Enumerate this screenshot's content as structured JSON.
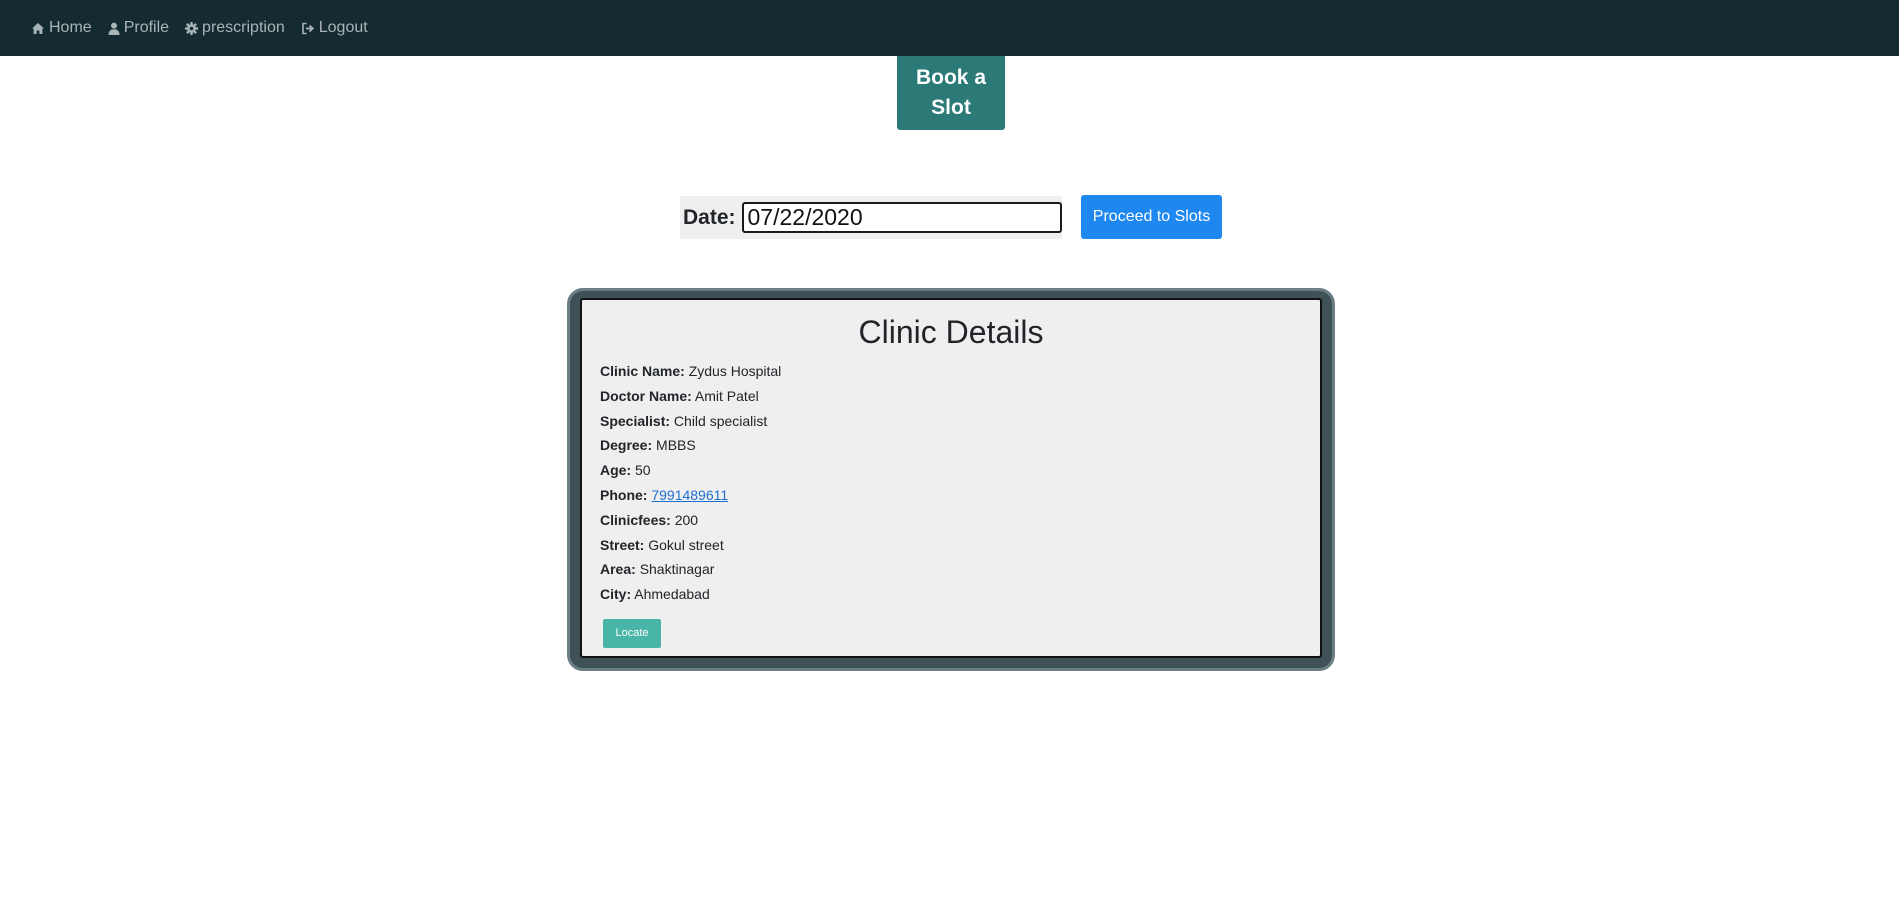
{
  "nav": {
    "items": [
      {
        "label": "Home",
        "icon": "home-icon"
      },
      {
        "label": "Profile",
        "icon": "user-icon"
      },
      {
        "label": "prescription",
        "icon": "gear-icon"
      },
      {
        "label": "Logout",
        "icon": "logout-icon"
      }
    ]
  },
  "book_slot": {
    "line1": "Book a",
    "line2": "Slot"
  },
  "date_form": {
    "label": "Date:",
    "value": "07/22/2020",
    "proceed_label": "Proceed to Slots"
  },
  "clinic": {
    "title": "Clinic Details",
    "fields": [
      {
        "label": "Clinic Name:",
        "value": "Zydus Hospital"
      },
      {
        "label": "Doctor Name:",
        "value": "Amit Patel"
      },
      {
        "label": "Specialist:",
        "value": "Child specialist"
      },
      {
        "label": "Degree:",
        "value": "MBBS"
      },
      {
        "label": "Age:",
        "value": "50"
      },
      {
        "label": "Phone:",
        "value": "7991489611"
      },
      {
        "label": "Clinicfees:",
        "value": "200"
      },
      {
        "label": "Street:",
        "value": "Gokul street"
      },
      {
        "label": "Area:",
        "value": "Shaktinagar"
      },
      {
        "label": "City:",
        "value": "Ahmedabad"
      }
    ],
    "locate_label": "Locate"
  },
  "colors": {
    "navbar_bg": "#152b32",
    "book_slot_bg": "#2b7a78",
    "proceed_bg": "#1e88f0",
    "locate_bg": "#48b5a8",
    "card_frame": "#3d5157",
    "link": "#1f6fd1"
  }
}
